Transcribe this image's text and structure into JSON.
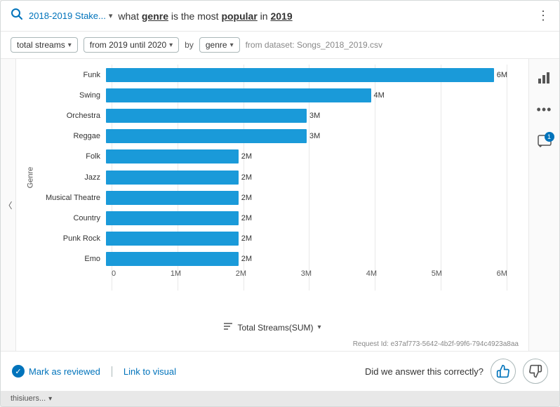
{
  "header": {
    "search_icon": "🔍",
    "breadcrumb_label": "2018-2019 Stake...",
    "breadcrumb_chevron": "▾",
    "query_prefix": "what ",
    "query_genre": "genre",
    "query_middle": " is the most ",
    "query_popular": "popular",
    "query_suffix": " in ",
    "query_year": "2019",
    "more_icon": "⋮"
  },
  "filters": {
    "streams_label": "total streams",
    "streams_caret": "▾",
    "date_label": "from 2019 until 2020",
    "date_caret": "▾",
    "by_label": "by",
    "genre_label": "genre",
    "genre_caret": "▾",
    "dataset_label": "from dataset: Songs_2018_2019.csv"
  },
  "chart": {
    "y_axis_label": "Genre",
    "bars": [
      {
        "label": "Funk",
        "value_label": "6M",
        "pct": 100
      },
      {
        "label": "Swing",
        "value_label": "4M",
        "pct": 66
      },
      {
        "label": "Orchestra",
        "value_label": "3M",
        "pct": 50
      },
      {
        "label": "Reggae",
        "value_label": "3M",
        "pct": 50
      },
      {
        "label": "Folk",
        "value_label": "2M",
        "pct": 33
      },
      {
        "label": "Jazz",
        "value_label": "2M",
        "pct": 33
      },
      {
        "label": "Musical Theatre",
        "value_label": "2M",
        "pct": 33
      },
      {
        "label": "Country",
        "value_label": "2M",
        "pct": 33
      },
      {
        "label": "Punk Rock",
        "value_label": "2M",
        "pct": 33
      },
      {
        "label": "Emo",
        "value_label": "2M",
        "pct": 33
      }
    ],
    "x_ticks": [
      "0",
      "1M",
      "2M",
      "3M",
      "4M",
      "5M",
      "6M"
    ],
    "title_icon": "≡",
    "title_label": "Total Streams(SUM)",
    "title_caret": "▾"
  },
  "request_id": "Request Id: e37af773-5642-4b2f-99f6-794c4923a8aa",
  "sidebar": {
    "chart_icon": "📊",
    "more_icon": "•••",
    "comment_icon": "💬",
    "badge": "1"
  },
  "footer": {
    "check_icon": "✓",
    "mark_reviewed": "Mark as reviewed",
    "link_visual": "Link to visual",
    "question": "Did we answer this correctly?",
    "thumbs_up": "👍",
    "thumbs_down": "👎"
  },
  "bottom_strip": {
    "label": "thisiuers...",
    "caret": "▾"
  }
}
